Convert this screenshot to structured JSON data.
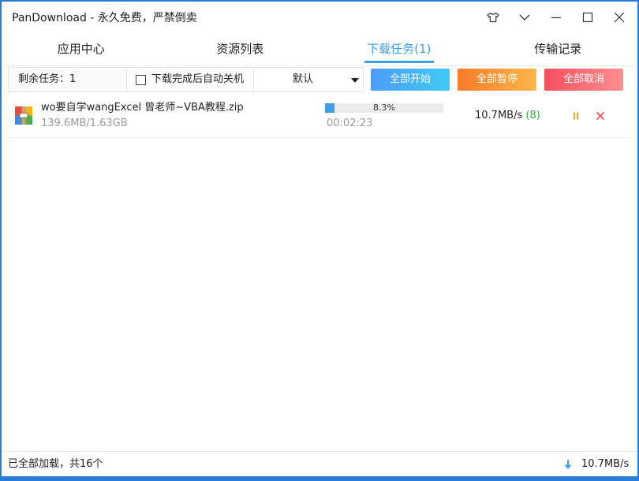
{
  "window": {
    "title": "PanDownload - 永久免费，严禁倒卖",
    "controls": [
      "skin-icon",
      "chevron-down-icon",
      "minimize-icon",
      "maximize-icon",
      "close-icon"
    ]
  },
  "tabs": [
    {
      "label": "应用中心",
      "active": false
    },
    {
      "label": "资源列表",
      "active": false
    },
    {
      "label": "下载任务(1)",
      "active": true
    },
    {
      "label": "传输记录",
      "active": false
    }
  ],
  "toolbar": {
    "remaining": "剩余任务：1",
    "auto_shutdown_label": "下载完成后自动关机",
    "auto_shutdown_checked": false,
    "sort_selected": "默认",
    "start_all": "全部开始",
    "pause_all": "全部暂停",
    "cancel_all": "全部取消"
  },
  "downloads": [
    {
      "icon": "zip-archive-icon",
      "name": "wo要自学wangExcel 曾老师~VBA教程.zip",
      "size": "139.6MB/1.63GB",
      "progress": "8.3%",
      "time_left": "00:02:23",
      "speed": "10.7MB/s",
      "threads": "(8)",
      "actions": [
        "pause-icon",
        "cancel-icon"
      ]
    }
  ],
  "status": {
    "message": "已全部加载，共16个",
    "icon": "download-arrow-icon",
    "total_speed": "10.7MB/s"
  },
  "theme": {
    "frame": "#2b7cd8",
    "accent": "#3f9ee8",
    "threads": "#2fae3a",
    "pause": "#f5a623",
    "cancel": "#e84a4a"
  }
}
